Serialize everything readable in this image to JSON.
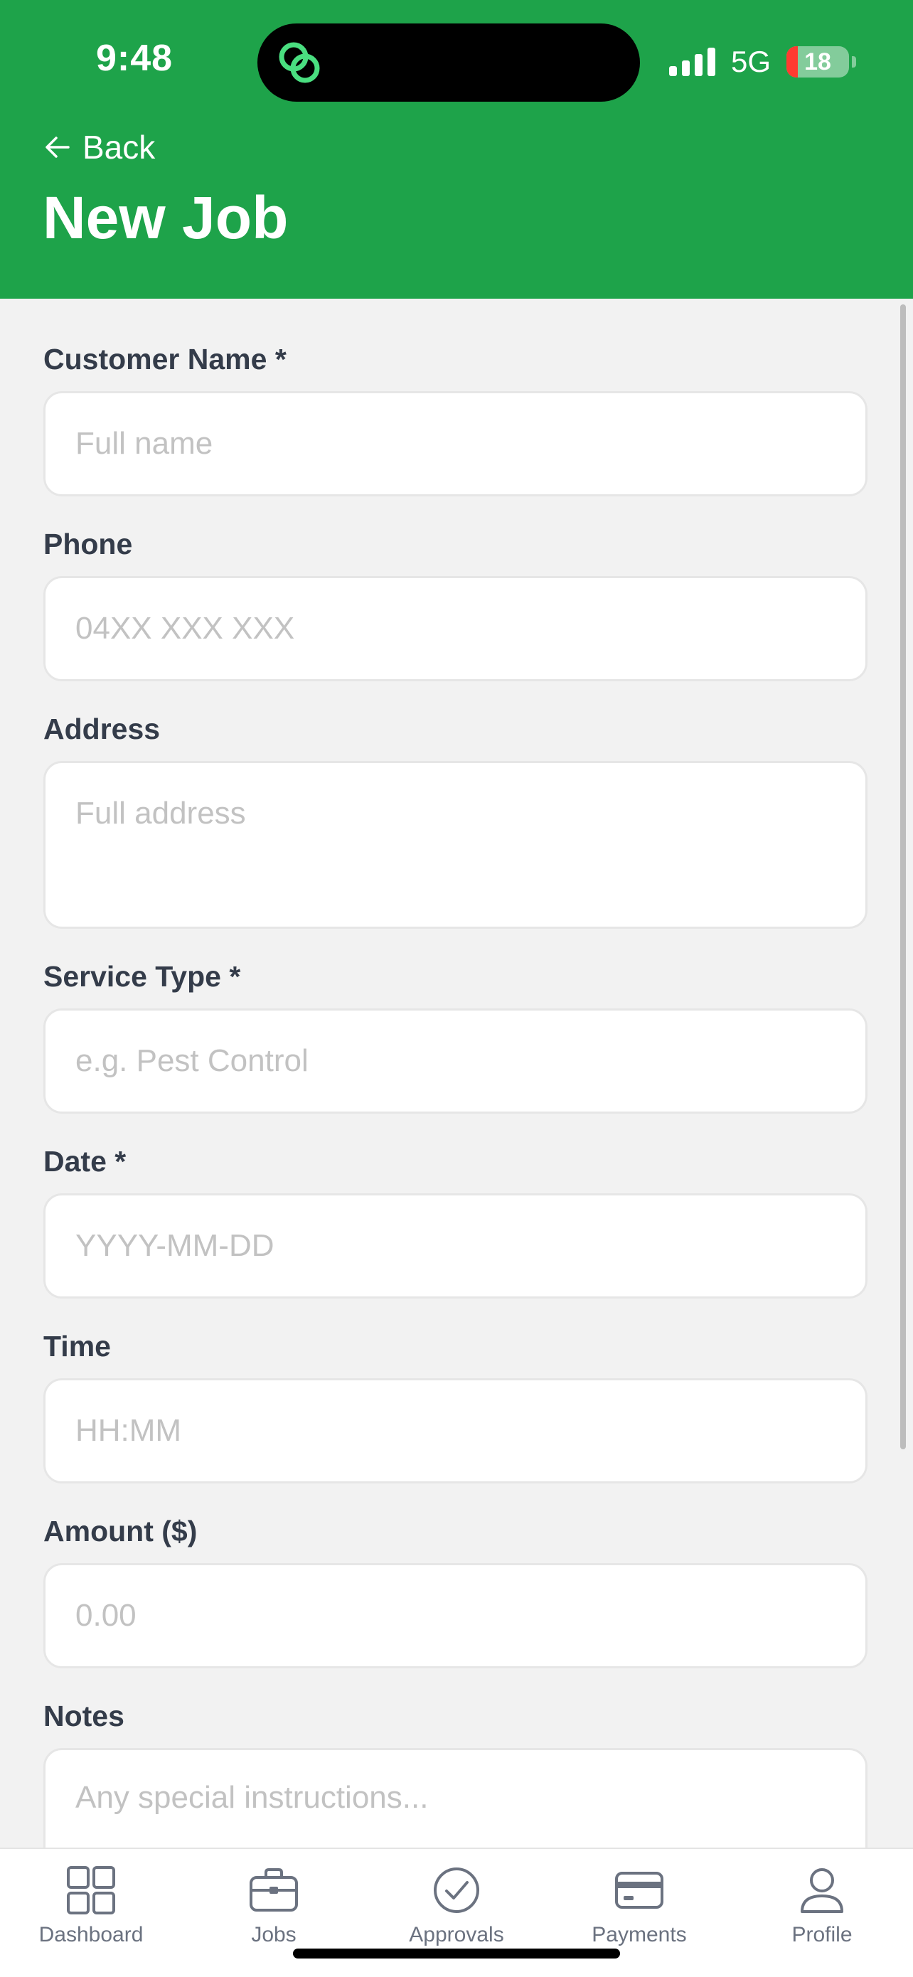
{
  "status_bar": {
    "time": "9:48",
    "network": "5G",
    "battery": "18"
  },
  "header": {
    "back_label": "Back",
    "title": "New Job",
    "color": "#1ea34a"
  },
  "form": {
    "fields": [
      {
        "label": "Customer Name *",
        "placeholder": "Full name"
      },
      {
        "label": "Phone",
        "placeholder": "04XX XXX XXX"
      },
      {
        "label": "Address",
        "placeholder": "Full address"
      },
      {
        "label": "Service Type *",
        "placeholder": "e.g. Pest Control"
      },
      {
        "label": "Date *",
        "placeholder": "YYYY-MM-DD"
      },
      {
        "label": "Time",
        "placeholder": "HH:MM"
      },
      {
        "label": "Amount ($)",
        "placeholder": "0.00"
      },
      {
        "label": "Notes",
        "placeholder": "Any special instructions..."
      }
    ]
  },
  "tabbar": {
    "tabs": [
      {
        "label": "Dashboard",
        "icon": "grid-icon"
      },
      {
        "label": "Jobs",
        "icon": "briefcase-icon"
      },
      {
        "label": "Approvals",
        "icon": "check-circle-icon"
      },
      {
        "label": "Payments",
        "icon": "card-icon"
      },
      {
        "label": "Profile",
        "icon": "person-icon"
      }
    ]
  }
}
